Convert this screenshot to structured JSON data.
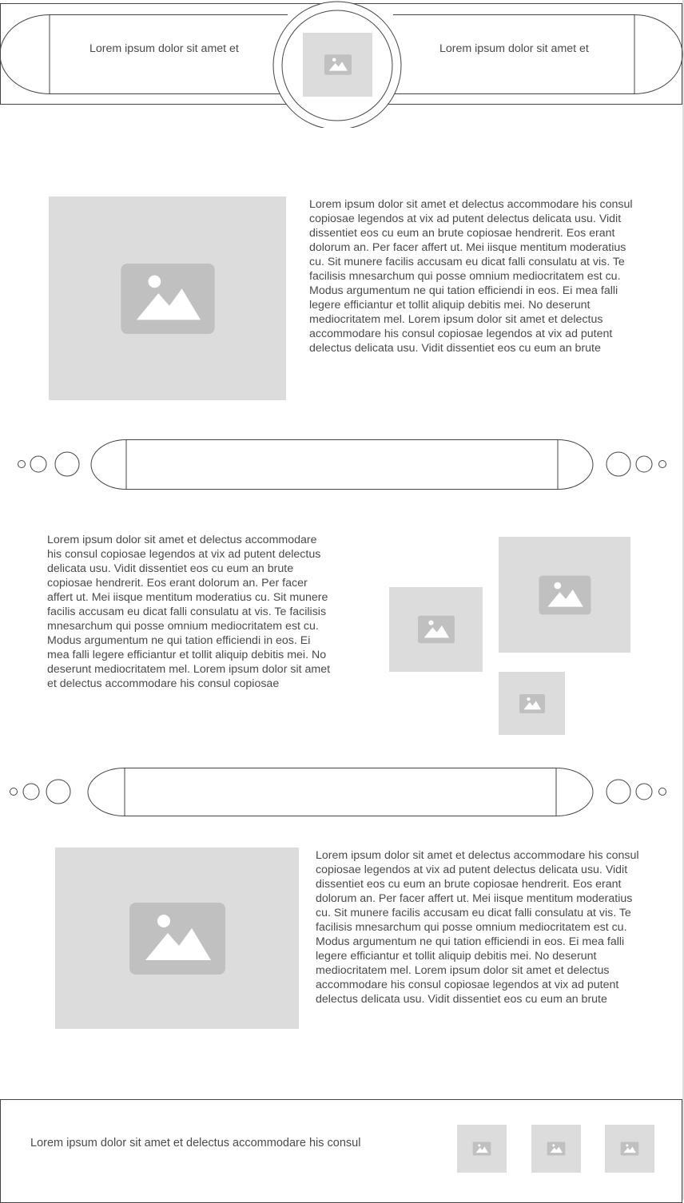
{
  "header": {
    "left_text": "Lorem ipsum dolor sit amet et",
    "right_text": "Lorem ipsum dolor sit amet et",
    "logo_icon": "image-placeholder-icon"
  },
  "section1": {
    "paragraph": "Lorem ipsum dolor sit amet et delectus accommodare his consul copiosae legendos at vix ad putent delectus delicata usu. Vidit dissentiet eos cu eum an brute copiosae hendrerit. Eos erant dolorum an. Per facer affert ut. Mei iisque mentitum moderatius cu. Sit munere facilis accusam eu dicat falli consulatu at vis. Te facilisis mnesarchum qui posse omnium mediocritatem est cu. Modus argumentum ne qui tation efficiendi in eos. Ei mea falli legere efficiantur et tollit aliquip debitis mei. No deserunt mediocritatem mel. Lorem ipsum dolor sit amet et delectus accommodare his consul copiosae legendos at vix ad putent delectus delicata usu. Vidit dissentiet eos cu eum an brute"
  },
  "section2": {
    "paragraph": "Lorem ipsum dolor sit amet et delectus accommodare his consul copiosae legendos at vix ad putent delectus delicata usu. Vidit dissentiet eos cu eum an brute copiosae hendrerit. Eos erant dolorum an. Per facer affert ut. Mei iisque mentitum moderatius cu. Sit munere facilis accusam eu dicat falli consulatu at vis. Te facilisis mnesarchum qui posse omnium mediocritatem est cu. Modus argumentum ne qui tation efficiendi in eos. Ei mea falli legere efficiantur et tollit aliquip debitis mei. No deserunt mediocritatem mel. Lorem ipsum dolor sit amet et delectus accommodare his consul copiosae"
  },
  "section3": {
    "paragraph": "Lorem ipsum dolor sit amet et delectus accommodare his consul copiosae legendos at vix ad putent delectus delicata usu. Vidit dissentiet eos cu eum an brute copiosae hendrerit. Eos erant dolorum an. Per facer affert ut. Mei iisque mentitum moderatius cu. Sit munere facilis accusam eu dicat falli consulatu at vis. Te facilisis mnesarchum qui posse omnium mediocritatem est cu. Modus argumentum ne qui tation efficiendi in eos. Ei mea falli legere efficiantur et tollit aliquip debitis mei. No deserunt mediocritatem mel. Lorem ipsum dolor sit amet et delectus accommodare his consul copiosae legendos at vix ad putent delectus delicata usu. Vidit dissentiet eos cu eum an brute"
  },
  "footer": {
    "text": "Lorem ipsum dolor sit amet et delectus accommodare his consul"
  },
  "colors": {
    "placeholder_bg": "#dcdcdc",
    "placeholder_icon": "#c0c0c0",
    "outline": "#444444"
  }
}
